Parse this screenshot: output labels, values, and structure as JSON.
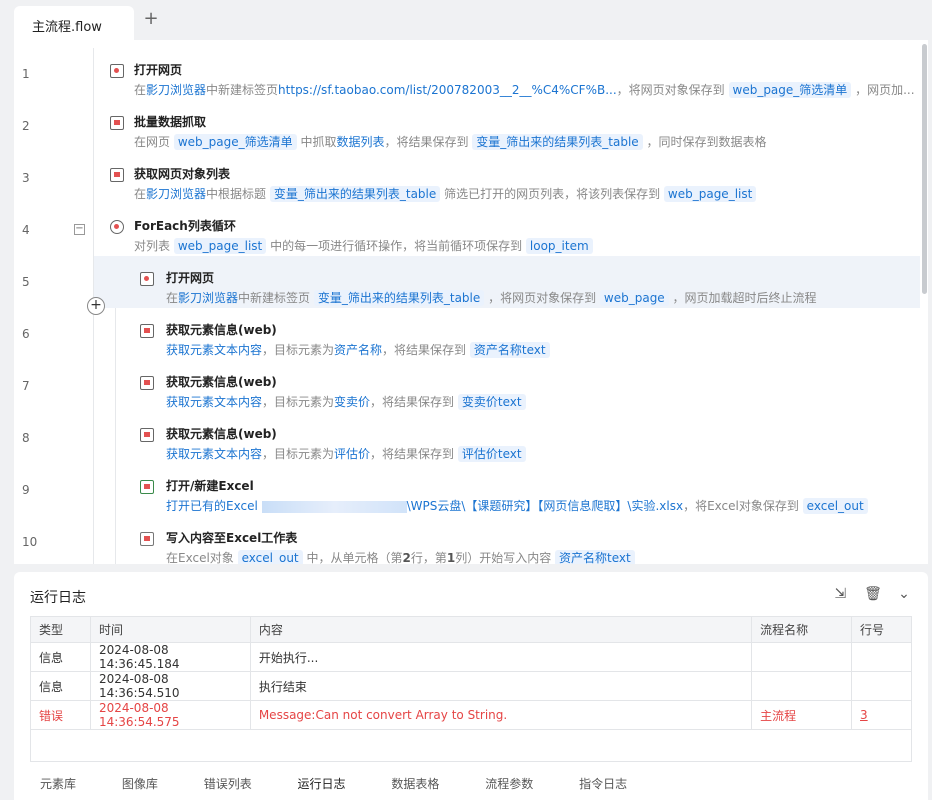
{
  "tabs": {
    "main": "主流程.flow",
    "add": "+"
  },
  "gutter": {
    "lines": [
      "1",
      "2",
      "3",
      "4",
      "5",
      "6",
      "7",
      "8",
      "9",
      "10"
    ],
    "collapse": "−",
    "add": "+"
  },
  "steps": [
    {
      "title": "打开网页",
      "d": [
        "在",
        "影刀浏览器",
        "中新建标签页",
        "https://sf.taobao.com/list/200782003__2__%C4%CF%B...",
        "，将网页对象保存到 ",
        "web_page_筛选清单",
        " ，网页加..."
      ]
    },
    {
      "title": "批量数据抓取",
      "d": [
        "在网页 ",
        "web_page_筛选清单",
        " 中抓取",
        "数据列表",
        "，将结果保存到 ",
        "变量_筛出来的结果列表_table",
        " ，同时保存到数据表格"
      ]
    },
    {
      "title": "获取网页对象列表",
      "d": [
        "在",
        "影刀浏览器",
        "中根据标题 ",
        "变量_筛出来的结果列表_table",
        " 筛选已打开的网页列表，将该列表保存到 ",
        "web_page_list"
      ]
    },
    {
      "title": "ForEach列表循环",
      "d": [
        "对列表 ",
        "web_page_list",
        " 中的每一项进行循环操作，将当前循环项保存到 ",
        "loop_item"
      ]
    },
    {
      "title": "打开网页",
      "d": [
        "在",
        "影刀浏览器",
        "中新建标签页 ",
        "变量_筛出来的结果列表_table",
        " ，将网页对象保存到 ",
        "web_page",
        " ，网页加载超时后终止流程"
      ]
    },
    {
      "title": "获取元素信息(web)",
      "d": [
        "获取元素文本内容",
        "，目标元素为",
        "资产名称",
        "，将结果保存到 ",
        "资产名称text"
      ]
    },
    {
      "title": "获取元素信息(web)",
      "d": [
        "获取元素文本内容",
        "，目标元素为",
        "变卖价",
        "，将结果保存到 ",
        "变卖价text"
      ]
    },
    {
      "title": "获取元素信息(web)",
      "d": [
        "获取元素文本内容",
        "，目标元素为",
        "评估价",
        "，将结果保存到 ",
        "评估价text"
      ]
    },
    {
      "title": "打开/新建Excel",
      "d": [
        "打开已有的Excel ",
        "\\WPS云盘\\【课题研究】【网页信息爬取】\\实验.xlsx",
        "，将Excel对象保存到 ",
        "excel_out"
      ]
    },
    {
      "title": "写入内容至Excel工作表",
      "d": [
        "在Excel对象 ",
        "excel_out",
        " 中，从单元格（第",
        "2",
        "行，第",
        "1",
        "列）开始写入内容 ",
        "资产名称text"
      ]
    }
  ],
  "log": {
    "title": "运行日志",
    "headers": [
      "类型",
      "时间",
      "内容",
      "流程名称",
      "行号"
    ],
    "rows": [
      [
        "信息",
        "2024-08-08 14:36:45.184",
        "开始执行...",
        "",
        ""
      ],
      [
        "信息",
        "2024-08-08 14:36:54.510",
        "执行结束",
        "",
        ""
      ],
      [
        "错误",
        "2024-08-08 14:36:54.575",
        "Message:Can not convert Array to String.",
        "主流程",
        "3"
      ]
    ],
    "tabs": [
      "元素库",
      "图像库",
      "错误列表",
      "运行日志",
      "数据表格",
      "流程参数",
      "指令日志"
    ],
    "icons": [
      "export-icon",
      "trash-icon",
      "chevron-down-icon"
    ]
  },
  "colors": {
    "link": "#1b74d1",
    "error": "#e54545",
    "selected_row": "#eff3f9"
  }
}
